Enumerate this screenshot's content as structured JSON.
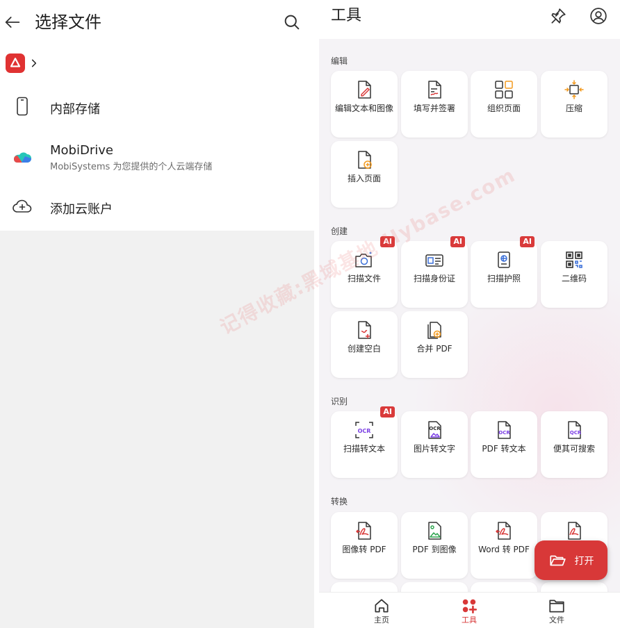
{
  "left": {
    "title": "选择文件",
    "locations": [
      {
        "title": "内部存储",
        "subtitle": ""
      },
      {
        "title": "MobiDrive",
        "subtitle": "MobiSystems 为您提供的个人云端存储"
      },
      {
        "title": "添加云账户",
        "subtitle": ""
      }
    ]
  },
  "right": {
    "title": "工具",
    "sections": [
      {
        "label": "编辑",
        "tiles": [
          "编辑文本和图像",
          "填写并签署",
          "组织页面",
          "压缩",
          "插入页面"
        ]
      },
      {
        "label": "创建",
        "tiles": [
          "扫描文件",
          "扫描身份证",
          "扫描护照",
          "二维码",
          "创建空白",
          "合并 PDF"
        ]
      },
      {
        "label": "识别",
        "tiles": [
          "扫描转文本",
          "图片转文字",
          "PDF 转文本",
          "便其可搜索"
        ]
      },
      {
        "label": "转换",
        "tiles": [
          "图像转 PDF",
          "PDF 到图像",
          "Word 转 PDF"
        ]
      }
    ],
    "ai_badge": "AI",
    "fab_label": "打开",
    "nav": [
      "主页",
      "工具",
      "文件"
    ]
  },
  "watermark": "记得收藏:黑域基地 Hybase.com",
  "colors": {
    "accent": "#d83838",
    "orange": "#f39a1e",
    "blue": "#3a6fd8",
    "purple": "#7b3fe4",
    "green": "#2ea44f"
  }
}
